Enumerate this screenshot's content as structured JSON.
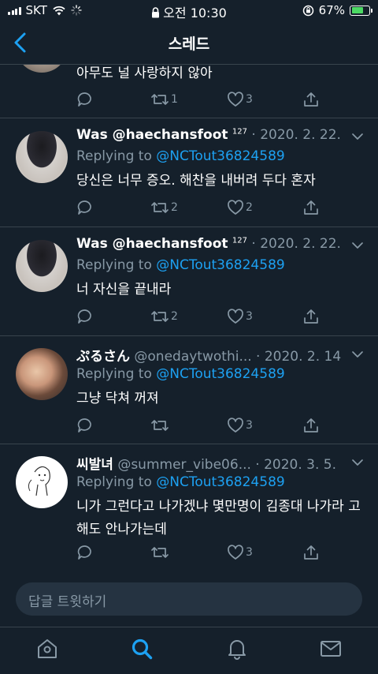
{
  "status": {
    "carrier": "SKT",
    "time": "오전 10:30",
    "battery": "67%",
    "battery_level": 0.67
  },
  "nav": {
    "title": "스레드"
  },
  "tweets": [
    {
      "text": "아무도 널 사랑하지 않아",
      "retweets": "1",
      "likes": "3"
    },
    {
      "name": "Was @haechansfoot",
      "name_suffix": "127",
      "meta": " · 2020. 2. 22.",
      "replying_label": "Replying to",
      "replying_handle": "@NCTout36824589",
      "text": "당신은 너무 증오. 해찬을 내버려 두다 혼자",
      "retweets": "2",
      "likes": "2"
    },
    {
      "name": "Was @haechansfoot",
      "name_suffix": "127",
      "meta": " · 2020. 2. 22.",
      "replying_label": "Replying to",
      "replying_handle": "@NCTout36824589",
      "text": "너 자신을 끝내라",
      "retweets": "2",
      "likes": "3"
    },
    {
      "name": "ぷるさん",
      "meta": " @onedaytwothi... · 2020. 2. 14.",
      "replying_label": "Replying to",
      "replying_handle": "@NCTout36824589",
      "text": "그냥 닥쳐 꺼져",
      "likes": "3"
    },
    {
      "name": "씨발녀",
      "meta": " @summer_vibe06... · 2020. 3. 5.",
      "replying_label": "Replying to",
      "replying_handle": "@NCTout36824589",
      "text": "니가 그런다고 나가겠냐 몇만명이 김종대 나가라 고 해도 안나가는데",
      "likes": "3"
    }
  ],
  "composer": {
    "placeholder": "답글 트윗하기"
  },
  "tabs": [
    {
      "icon": "home-icon"
    },
    {
      "icon": "search-icon"
    },
    {
      "icon": "bell-icon"
    },
    {
      "icon": "mail-icon"
    }
  ],
  "colors": {
    "background": "#15202b",
    "accent": "#1da1f2",
    "muted": "#8899a6",
    "divider": "#38444d"
  }
}
